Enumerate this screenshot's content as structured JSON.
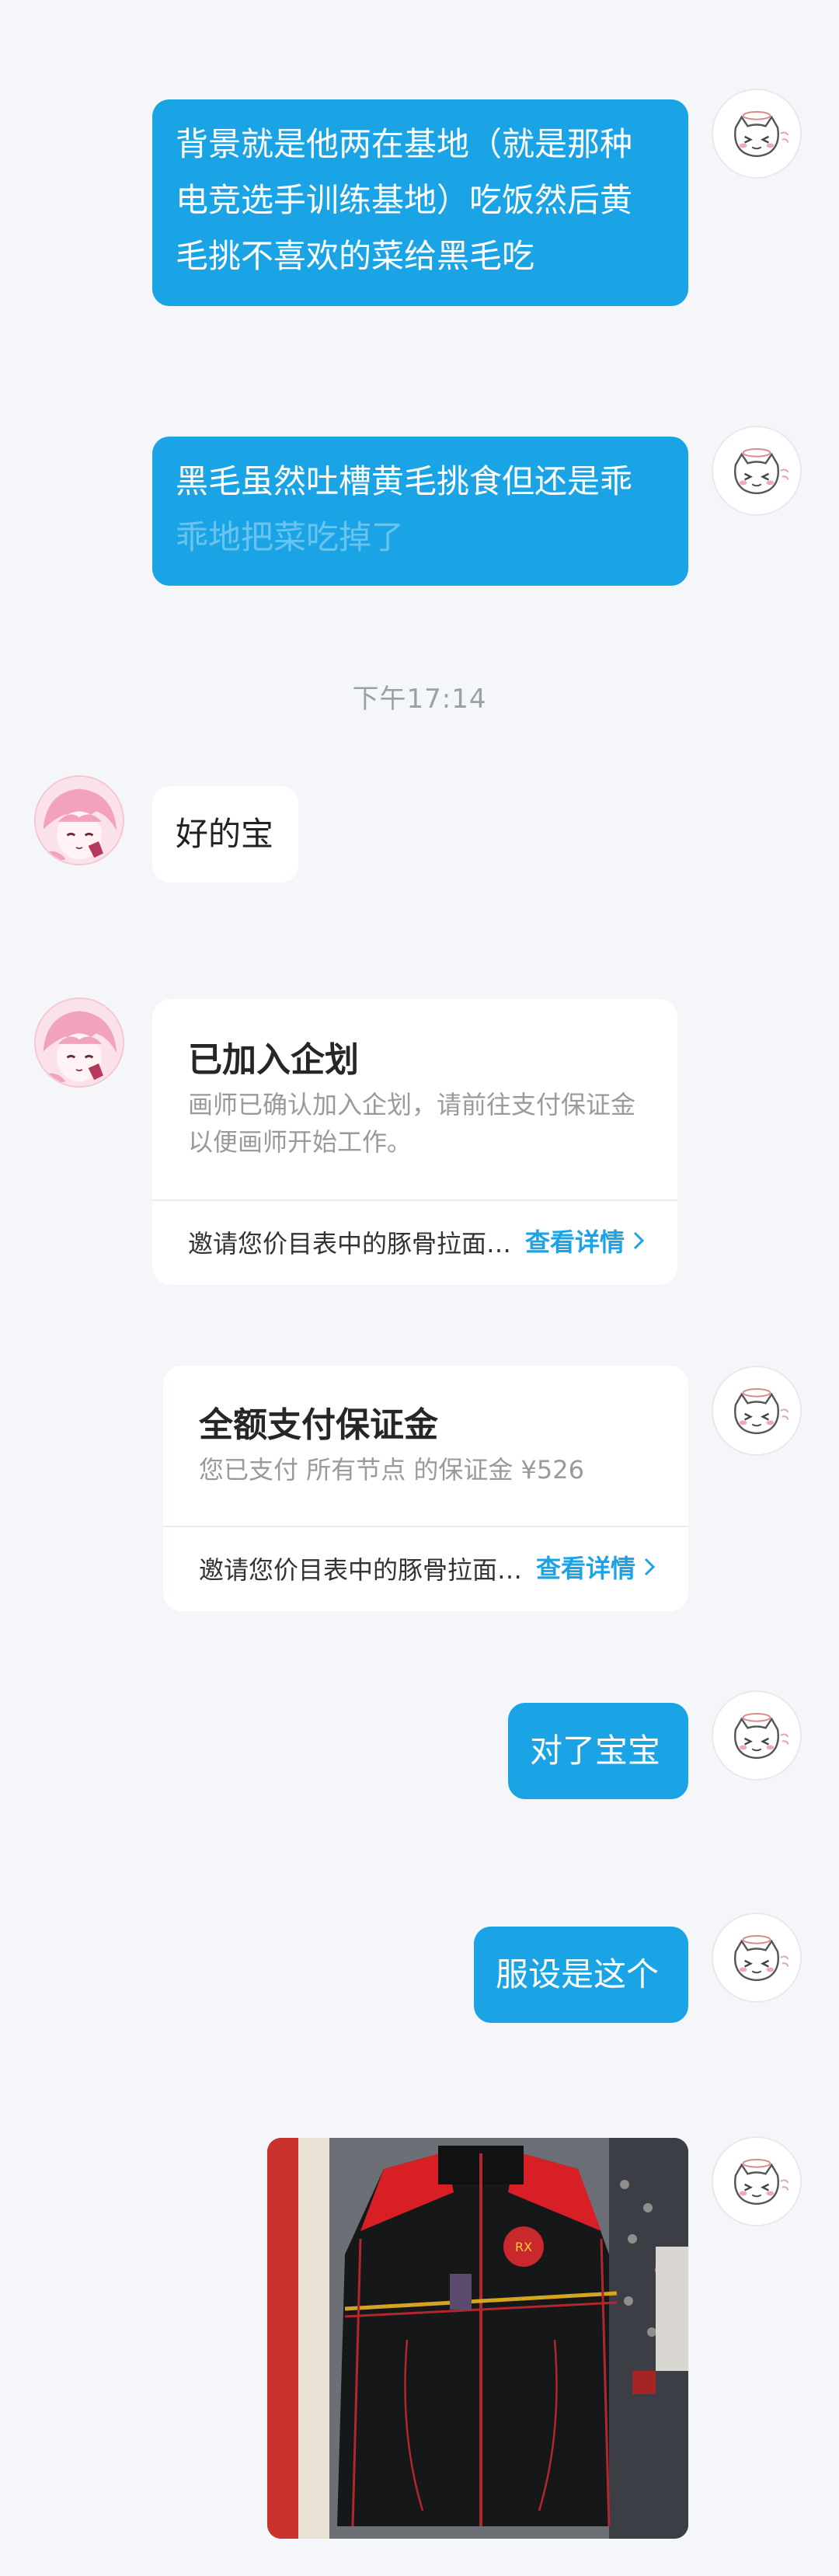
{
  "messages": {
    "m1": {
      "lines": [
        "背景就是他两在基地（就是那种",
        "电竞选手训练基地）吃饭然后黄",
        "毛挑不喜欢的菜给黑毛吃"
      ]
    },
    "m2": {
      "lines": [
        "黑毛虽然吐槽黄毛挑食但还是乖",
        "乖地把菜吃掉了"
      ]
    },
    "timestamp": "下午17:14",
    "m3": {
      "text": "好的宝"
    },
    "card1": {
      "title": "已加入企划",
      "desc_lines": [
        "画师已确认加入企划，请前往支付保证金",
        "以便画师开始工作。"
      ],
      "footer": "邀请您价目表中的豚骨拉面…",
      "link": "查看详情"
    },
    "card2": {
      "title": "全额支付保证金",
      "desc": "您已支付 所有节点 的保证金 ¥526",
      "footer": "邀请您价目表中的豚骨拉面…",
      "link": "查看详情"
    },
    "m4": {
      "text": "对了宝宝"
    },
    "m5": {
      "text": "服设是这个"
    }
  },
  "colors": {
    "background": "#f4f6f9",
    "bubble_blue": "#1aa4e6",
    "link_blue": "#1aa4e6"
  },
  "icons": {
    "self_avatar": "cat-angel-avatar",
    "other_avatar": "pink-anime-avatar",
    "link_chevron": "chevron-right-icon"
  }
}
